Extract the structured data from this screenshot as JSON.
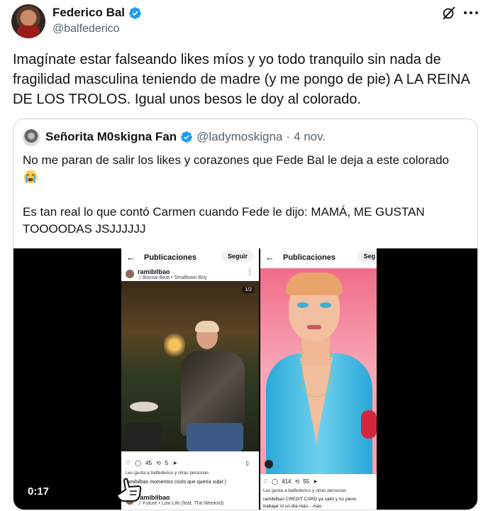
{
  "tweet": {
    "author_name": "Federico Bal",
    "author_handle": "@balfederico",
    "text": "Imagínate estar falseando likes míos y yo todo tranquilo sin nada de fragilidad masculina teniendo de madre (y me pongo de pie) A LA REINA DE LOS TROLOS. Igual unos besos le doy al colorado.",
    "icons": [
      "verified-badge-icon",
      "grok-icon",
      "more-icon"
    ]
  },
  "quote": {
    "author_name": "Señorita M0skigna Fan",
    "author_handle": "@ladymoskigna",
    "separator": "·",
    "date": "4 nov.",
    "text_line1": "No me paran de salir los likes y corazones que Fede Bal le deja a este colorado",
    "text_line2": " Es tan real lo que contó Carmen cuando Fede le dijo: MAMÁ, ME GUSTAN TOOOODAS JSJJJJJJ",
    "emoji": "crying-face-emoji"
  },
  "video": {
    "duration": "0:17",
    "screenshot1": {
      "title": "Publicaciones",
      "back": "←",
      "follow": "Seguir",
      "user": "ramibilbao",
      "music": "♫ Bonsai Beat • Smalltown Boy",
      "counter": "1/2",
      "likes_count": "45",
      "reposts_count": "5",
      "likes_line": "Les gusta a balfederico y otras personas",
      "caption": "ramibilbao momentos cools que quería subir:)",
      "next_user": "ramibilbao",
      "next_music": "♫ Future • Low Life (feat. The Weeknd)"
    },
    "screenshot2": {
      "title": "Publicaciones",
      "back": "←",
      "follow": "Seg",
      "comments_count": "414",
      "reposts_count": "55",
      "likes_line": "Les gusta a balfederico y otras personas",
      "caption": "ramibilbao CREDIT CARD ya salió y no piens",
      "caption2": "trabajar ni un día más... más"
    }
  }
}
